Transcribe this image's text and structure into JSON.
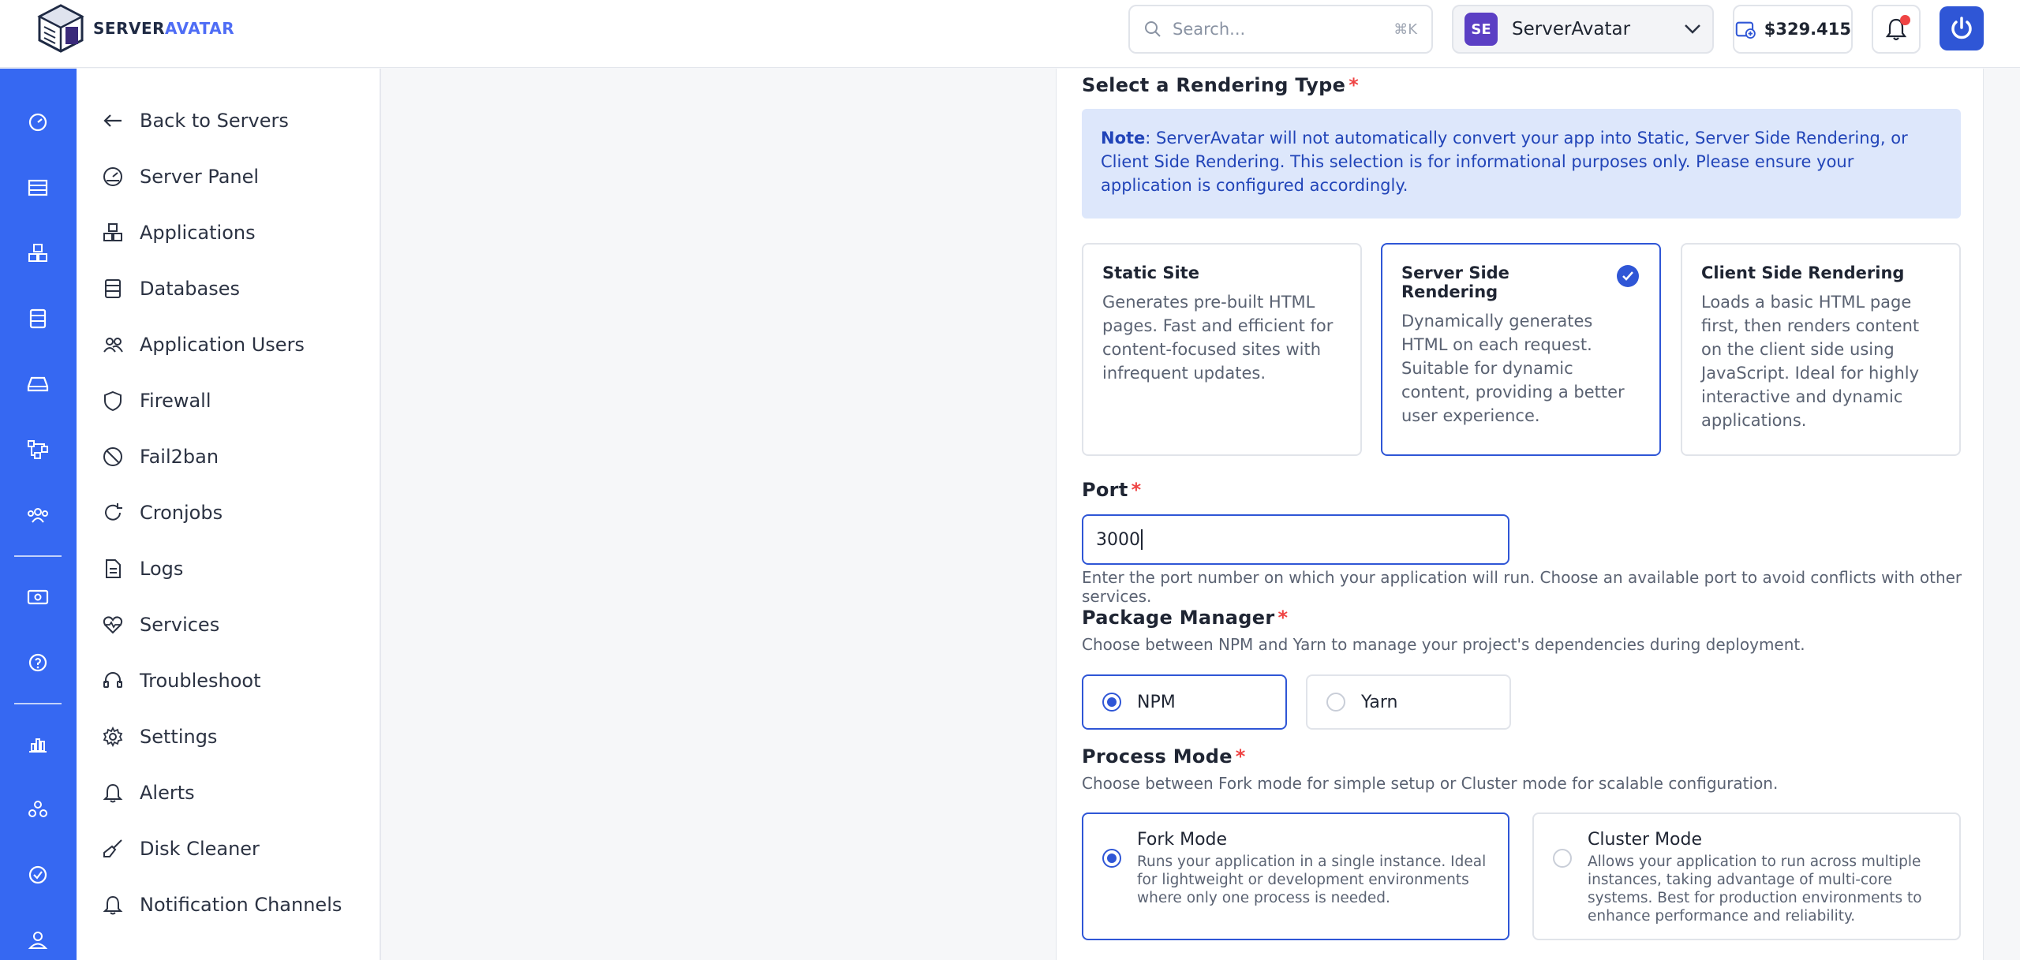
{
  "brand": {
    "name_part1": "SERVER",
    "name_part2": "AVATAR"
  },
  "search": {
    "placeholder": "Search...",
    "shortcut": "⌘K"
  },
  "team": {
    "initials": "SE",
    "name": "ServerAvatar"
  },
  "balance": "$329.415",
  "sidebar": {
    "items": [
      {
        "label": "Back to Servers",
        "icon": "arrow-left-icon"
      },
      {
        "label": "Server Panel",
        "icon": "gauge-icon"
      },
      {
        "label": "Applications",
        "icon": "cubes-icon"
      },
      {
        "label": "Databases",
        "icon": "database-icon"
      },
      {
        "label": "Application Users",
        "icon": "users-icon"
      },
      {
        "label": "Firewall",
        "icon": "shield-icon"
      },
      {
        "label": "Fail2ban",
        "icon": "ban-icon"
      },
      {
        "label": "Cronjobs",
        "icon": "refresh-icon"
      },
      {
        "label": "Logs",
        "icon": "file-text-icon"
      },
      {
        "label": "Services",
        "icon": "heart-pulse-icon"
      },
      {
        "label": "Troubleshoot",
        "icon": "headset-icon"
      },
      {
        "label": "Settings",
        "icon": "gear-icon"
      },
      {
        "label": "Alerts",
        "icon": "bell-icon"
      },
      {
        "label": "Disk Cleaner",
        "icon": "broom-icon"
      },
      {
        "label": "Notification Channels",
        "icon": "bell-icon"
      }
    ]
  },
  "rendering": {
    "title": "Select a Rendering Type",
    "note_label": "Note",
    "note_text": ": ServerAvatar will not automatically convert your app into Static, Server Side Rendering, or Client Side Rendering. This selection is for informational purposes only. Please ensure your application is configured accordingly.",
    "options": [
      {
        "title": "Static Site",
        "desc": "Generates pre-built HTML pages. Fast and efficient for content-focused sites with infrequent updates.",
        "selected": false
      },
      {
        "title": "Server Side Rendering",
        "desc": "Dynamically generates HTML on each request. Suitable for dynamic content, providing a better user experience.",
        "selected": true
      },
      {
        "title": "Client Side Rendering",
        "desc": "Loads a basic HTML page first, then renders content on the client side using JavaScript. Ideal for highly interactive and dynamic applications.",
        "selected": false
      }
    ]
  },
  "port": {
    "label": "Port",
    "value": "3000",
    "help": "Enter the port number on which your application will run. Choose an available port to avoid conflicts with other services."
  },
  "package_manager": {
    "label": "Package Manager",
    "help": "Choose between NPM and Yarn to manage your project's dependencies during deployment.",
    "options": [
      {
        "label": "NPM",
        "selected": true
      },
      {
        "label": "Yarn",
        "selected": false
      }
    ]
  },
  "process_mode": {
    "label": "Process Mode",
    "help": "Choose between Fork mode for simple setup or Cluster mode for scalable configuration.",
    "options": [
      {
        "title": "Fork Mode",
        "desc": "Runs your application in a single instance. Ideal for lightweight or development environments where only one process is needed.",
        "selected": true
      },
      {
        "title": "Cluster Mode",
        "desc": "Allows your application to run across multiple instances, taking advantage of multi-core systems. Best for production environments to enhance performance and reliability.",
        "selected": false
      }
    ]
  },
  "required_mark": "*",
  "colors": {
    "primary": "#2f56d6",
    "rail": "#3668f2",
    "note_bg": "#dde7fb",
    "required": "#ef4444"
  }
}
